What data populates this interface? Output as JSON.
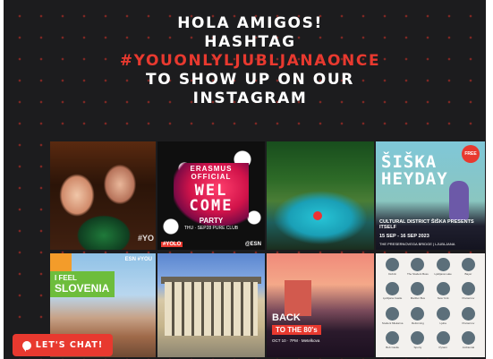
{
  "headline": {
    "line1": "HOLA AMIGOS!",
    "line2": "HASHTAG",
    "hashtag": "#YOUONLYLJUBLJANAONCE",
    "line4": "TO SHOW UP ON OUR",
    "line5": "INSTAGRAM"
  },
  "colors": {
    "background": "#1c1c1e",
    "accent": "#e8392f",
    "text": "#ffffff"
  },
  "posts": [
    {
      "tag": "#YO"
    },
    {
      "erasmus": "ERASMUS",
      "official": "OFFICIAL",
      "wel": "WEL",
      "come": "COME",
      "party": "PARTY",
      "dates": "THU · SEP28 PURE CLUB",
      "left_tag": "#YOLO",
      "right_tag": "@ESN"
    },
    {},
    {
      "badge": "FREE",
      "title_1": "ŠIŠKA",
      "title_2": "HEYDAY",
      "caption": "CULTURAL DISTRICT ŠIŠKA PRESENTS ITSELF",
      "dates": "15 SEP - 16 SEP 2023",
      "venue": "THE PRESERNOVEGA BRIDGE | LJUBLJANA"
    },
    {
      "esn": "ESN #YOU",
      "feel": "I FEEL",
      "country": "SLOVENIA"
    },
    {},
    {
      "back": "BACK",
      "pill": "TO THE 80's",
      "date": "OCT 10 · 7PM · Metelkova"
    },
    {
      "icon_labels": [
        "Dobrin",
        "The Student Boss",
        "Ljubljana Lake",
        "Bayer",
        "Ljubljana Castle",
        "Maribor Bus",
        "New York",
        "Prešernov",
        "Student Mlekarna",
        "Reforming",
        "Ljuba",
        "Prešernov",
        "Bob Castle",
        "Sporty",
        "Pyrami",
        "Ambiental"
      ]
    }
  ],
  "chat": {
    "label": "LET'S CHAT!",
    "icon": "chat-bubble-icon"
  }
}
